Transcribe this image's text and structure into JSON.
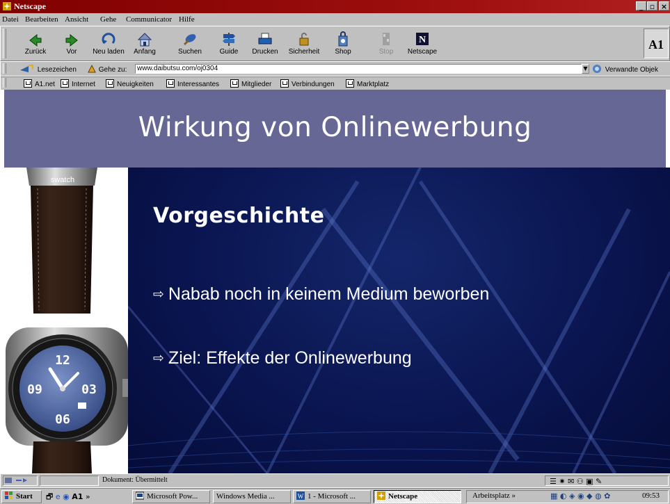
{
  "window": {
    "title": "Netscape"
  },
  "menu": [
    "Datei",
    "Bearbeiten",
    "Ansicht",
    "Gehe",
    "Communicator",
    "Hilfe"
  ],
  "toolbar": {
    "buttons": [
      "Zurück",
      "Vor",
      "Neu laden",
      "Anfang",
      "Suchen",
      "Guide",
      "Drucken",
      "Sicherheit",
      "Shop",
      "Stop",
      "Netscape"
    ],
    "logo": "A1"
  },
  "location": {
    "bookmarks_label": "Lesezeichen",
    "goto_label": "Gehe zu:",
    "url": "www.daibutsu.com/oj0304",
    "related_label": "Verwandte Objek"
  },
  "personal_toolbar": [
    "A1.net",
    "Internet",
    "Neuigkeiten",
    "Interessantes",
    "Mitglieder",
    "Verbindungen",
    "Marktplatz"
  ],
  "slide": {
    "title": "Wirkung von Onlinewerbung",
    "subtitle": "Vorgeschichte",
    "bullets": [
      "Nabab noch in keinem Medium beworben",
      "Ziel: Effekte der Onlinewerbung"
    ],
    "watch_brand": "swatch",
    "watch_numbers": [
      "12",
      "03",
      "06",
      "09"
    ]
  },
  "status": {
    "text": "Dokument: Übermittelt"
  },
  "taskbar": {
    "start_label": "Start",
    "quick_launch_extra": "»",
    "tasks": [
      {
        "label": "Microsoft Pow..."
      },
      {
        "label": "Windows Media ..."
      },
      {
        "label": "1 - Microsoft ..."
      },
      {
        "label": "Netscape",
        "active": true
      }
    ],
    "tray_label": "Arbeitsplatz",
    "tray_extra": "»",
    "clock": "09:53"
  },
  "colors": {
    "title_band": "#676796",
    "slide_bg": "#0a1550",
    "titlebar": "#800000"
  }
}
